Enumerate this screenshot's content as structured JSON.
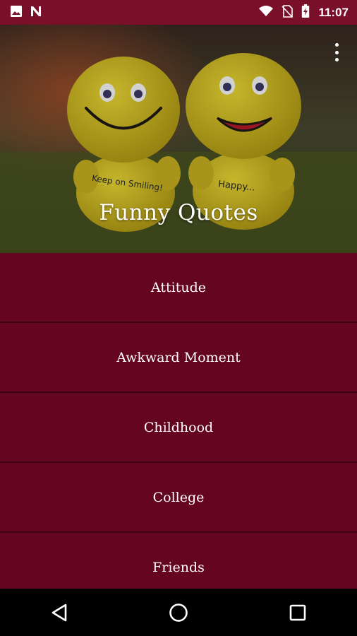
{
  "status_bar": {
    "time": "11:07",
    "icons": [
      "image-icon",
      "n-notification-icon",
      "wifi-icon",
      "no-sim-icon",
      "battery-charging-icon"
    ]
  },
  "header": {
    "title": "Funny Quotes",
    "menu_icon": "overflow-menu-icon",
    "image_text": {
      "left_toy": "Keep on Smiling!",
      "right_toy": "Happy..."
    }
  },
  "categories": [
    {
      "label": "Attitude"
    },
    {
      "label": "Awkward Moment"
    },
    {
      "label": "Childhood"
    },
    {
      "label": "College"
    },
    {
      "label": "Friends"
    }
  ],
  "nav_bar": {
    "icons": [
      "back-icon",
      "home-icon",
      "recents-icon"
    ]
  },
  "colors": {
    "status_bar": "#7a0f2a",
    "list_background": "#650620",
    "divider": "#3f0214",
    "nav_bar": "#000000"
  }
}
